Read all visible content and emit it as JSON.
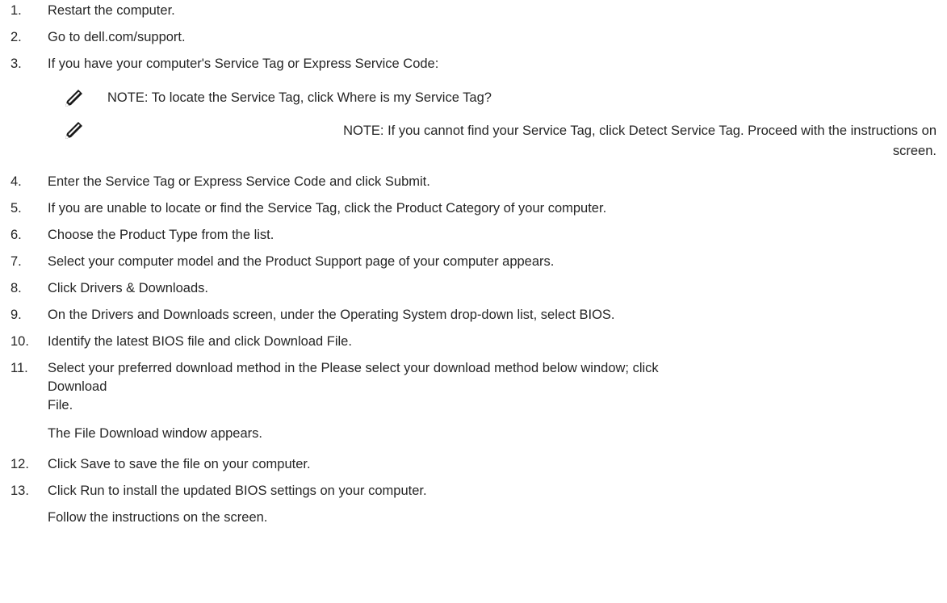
{
  "steps": [
    {
      "num": "1.",
      "text": "Restart the computer."
    },
    {
      "num": "2.",
      "text": "Go to dell.com/support."
    },
    {
      "num": "3.",
      "text": "If you have your computer's Service Tag or Express Service Code:"
    },
    {
      "num": "4.",
      "text": "Enter the Service Tag or Express Service Code and click Submit."
    },
    {
      "num": "5.",
      "text": "If you are unable to locate or find the Service Tag, click the Product Category of your computer."
    },
    {
      "num": "6.",
      "text": "Choose the Product Type from the list."
    },
    {
      "num": "7.",
      "text": "Select your computer model and the Product Support page of your computer appears."
    },
    {
      "num": "8.",
      "text": "Click Drivers & Downloads."
    },
    {
      "num": "9.",
      "text": "On the Drivers and Downloads screen, under the Operating System drop-down list, select BIOS."
    },
    {
      "num": "10.",
      "text": "Identify the latest BIOS file and click Download File."
    },
    {
      "num": "11.",
      "text": "Select your preferred download method in the Please select your download method below window; click"
    },
    {
      "num": "12.",
      "text": "Click Save to save the file on your computer."
    },
    {
      "num": "13.",
      "text": "Click Run to install the updated BIOS settings on your computer."
    }
  ],
  "notes": [
    {
      "text": "NOTE: To locate the Service Tag, click Where is my Service Tag?"
    },
    {
      "text": "NOTE: If you cannot find your Service Tag, click Detect Service Tag. Proceed with the instructions on",
      "continuation": "screen."
    }
  ],
  "step11_continuation": [
    "Download",
    "File.",
    "The File Download window appears."
  ],
  "step13_continuation": "Follow the instructions on the screen.",
  "icon": "note-pencil-icon"
}
